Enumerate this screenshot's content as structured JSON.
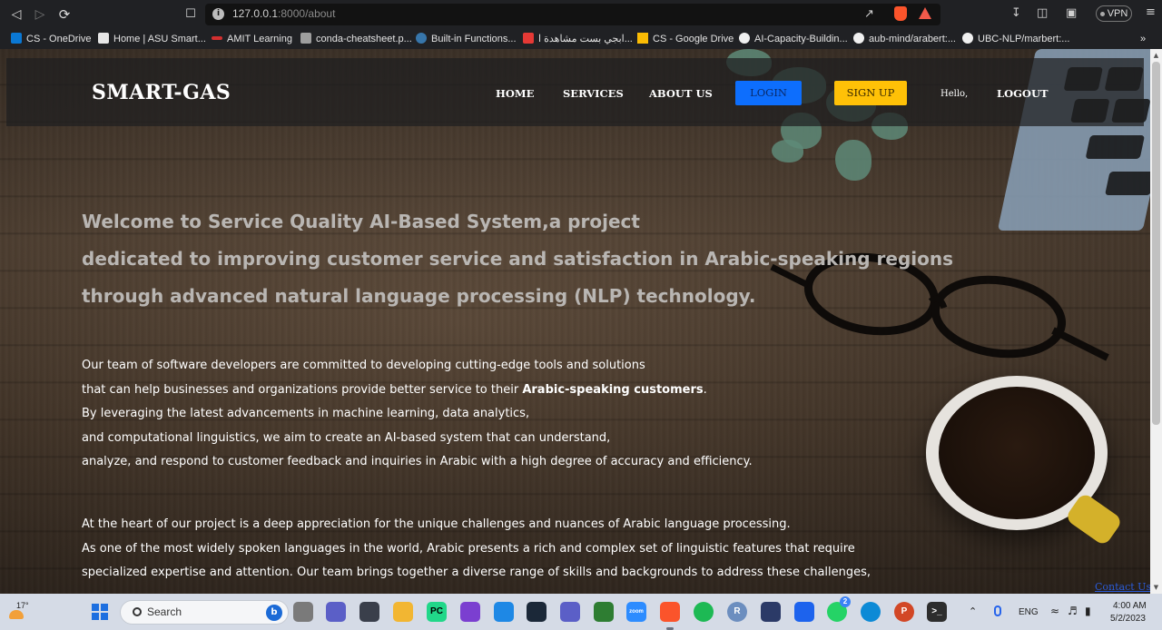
{
  "browser": {
    "url_host": "127.0.0.1",
    "url_path": ":8000/about",
    "vpn_label": "VPN"
  },
  "bookmarks": [
    {
      "label": "CS - OneDrive",
      "color": "#0a78d4"
    },
    {
      "label": "Home | ASU Smart...",
      "color": "#e6e6e6"
    },
    {
      "label": "AMIT Learning",
      "color": "#d32f2f"
    },
    {
      "label": "conda-cheatsheet.p...",
      "color": "#9e9e9e"
    },
    {
      "label": "Built-in Functions...",
      "color": "#3776ab"
    },
    {
      "label": "ابجي بست مشاهدة ا...",
      "color": "#e53935"
    },
    {
      "label": "CS - Google Drive",
      "color": "#fbbc04"
    },
    {
      "label": "AI-Capacity-Buildin...",
      "color": "#f0f0f0"
    },
    {
      "label": "aub-mind/arabert:...",
      "color": "#f0f0f0"
    },
    {
      "label": "UBC-NLP/marbert:...",
      "color": "#f0f0f0"
    }
  ],
  "site": {
    "brand": "SMART-GAS",
    "nav": {
      "home": "HOME",
      "services": "SERVICES",
      "about": "ABOUT US",
      "login": "LOGIN",
      "signup": "SIGN UP",
      "hello": "Hello,",
      "logout": "LOGOUT"
    },
    "headline": [
      "Welcome to Service Quality AI-Based System,a project",
      "dedicated to improving customer service and satisfaction in Arabic-speaking regions",
      "through advanced natural language processing (NLP) technology."
    ],
    "para1": {
      "l1": "Our team of software developers are committed to developing cutting-edge tools and solutions",
      "l2_pre": "that can help businesses and organizations provide better service to their ",
      "l2_bold": "Arabic-speaking customers",
      "l2_post": ".",
      "l3": "By leveraging the latest advancements in machine learning, data analytics,",
      "l4": "and computational linguistics, we aim to create an AI-based system that can understand,",
      "l5": "analyze, and respond to customer feedback and inquiries in Arabic with a high degree of accuracy and efficiency."
    },
    "para2": [
      "At the heart of our project is a deep appreciation for the unique challenges and nuances of Arabic language processing.",
      "As one of the most widely spoken languages in the world, Arabic presents a rich and complex set of linguistic features that require",
      "specialized expertise and attention. Our team brings together a diverse range of skills and backgrounds to address these challenges,"
    ],
    "contact": "Contact Us"
  },
  "taskbar": {
    "temperature": "17°",
    "search_placeholder": "Search",
    "language": "ENG",
    "time": "4:00 AM",
    "date": "5/2/2023",
    "whatsapp_badge": "2"
  },
  "colors": {
    "login": "#0d6efd",
    "signup": "#ffc107",
    "headline": "#b9b6b3"
  }
}
